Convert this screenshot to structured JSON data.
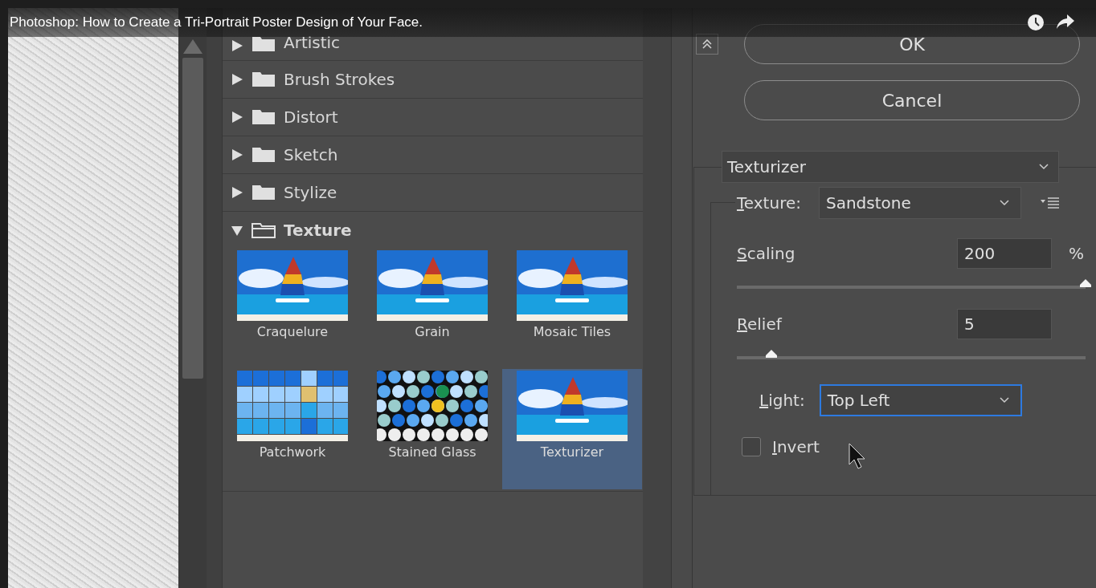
{
  "video": {
    "title": "Photoshop: How to Create a Tri-Portrait Poster Design of Your Face."
  },
  "filter_categories": [
    {
      "label": "Artistic",
      "expanded": false
    },
    {
      "label": "Brush Strokes",
      "expanded": false
    },
    {
      "label": "Distort",
      "expanded": false
    },
    {
      "label": "Sketch",
      "expanded": false
    },
    {
      "label": "Stylize",
      "expanded": false
    },
    {
      "label": "Texture",
      "expanded": true,
      "filters": [
        {
          "label": "Craquelure",
          "kind": "boat",
          "selected": false
        },
        {
          "label": "Grain",
          "kind": "boat",
          "selected": false
        },
        {
          "label": "Mosaic Tiles",
          "kind": "boat",
          "selected": false
        },
        {
          "label": "Patchwork",
          "kind": "patchwork",
          "selected": false
        },
        {
          "label": "Stained Glass",
          "kind": "glass",
          "selected": false
        },
        {
          "label": "Texturizer",
          "kind": "boat",
          "selected": true
        }
      ]
    }
  ],
  "ok_button": {
    "label": "OK"
  },
  "cancel_button": {
    "label": "Cancel"
  },
  "filter_select": {
    "value": "Texturizer"
  },
  "texture": {
    "label": "Texture:",
    "value": "Sandstone"
  },
  "sliders": [
    {
      "label": "Scaling",
      "value": "200",
      "unit": "%",
      "level": 1.0
    },
    {
      "label": "Relief",
      "value": "5",
      "level": 0.1
    }
  ],
  "light": {
    "label": "Light:",
    "value": "Top Left",
    "focused": true
  },
  "invert": {
    "label": "Invert",
    "checked": false
  }
}
